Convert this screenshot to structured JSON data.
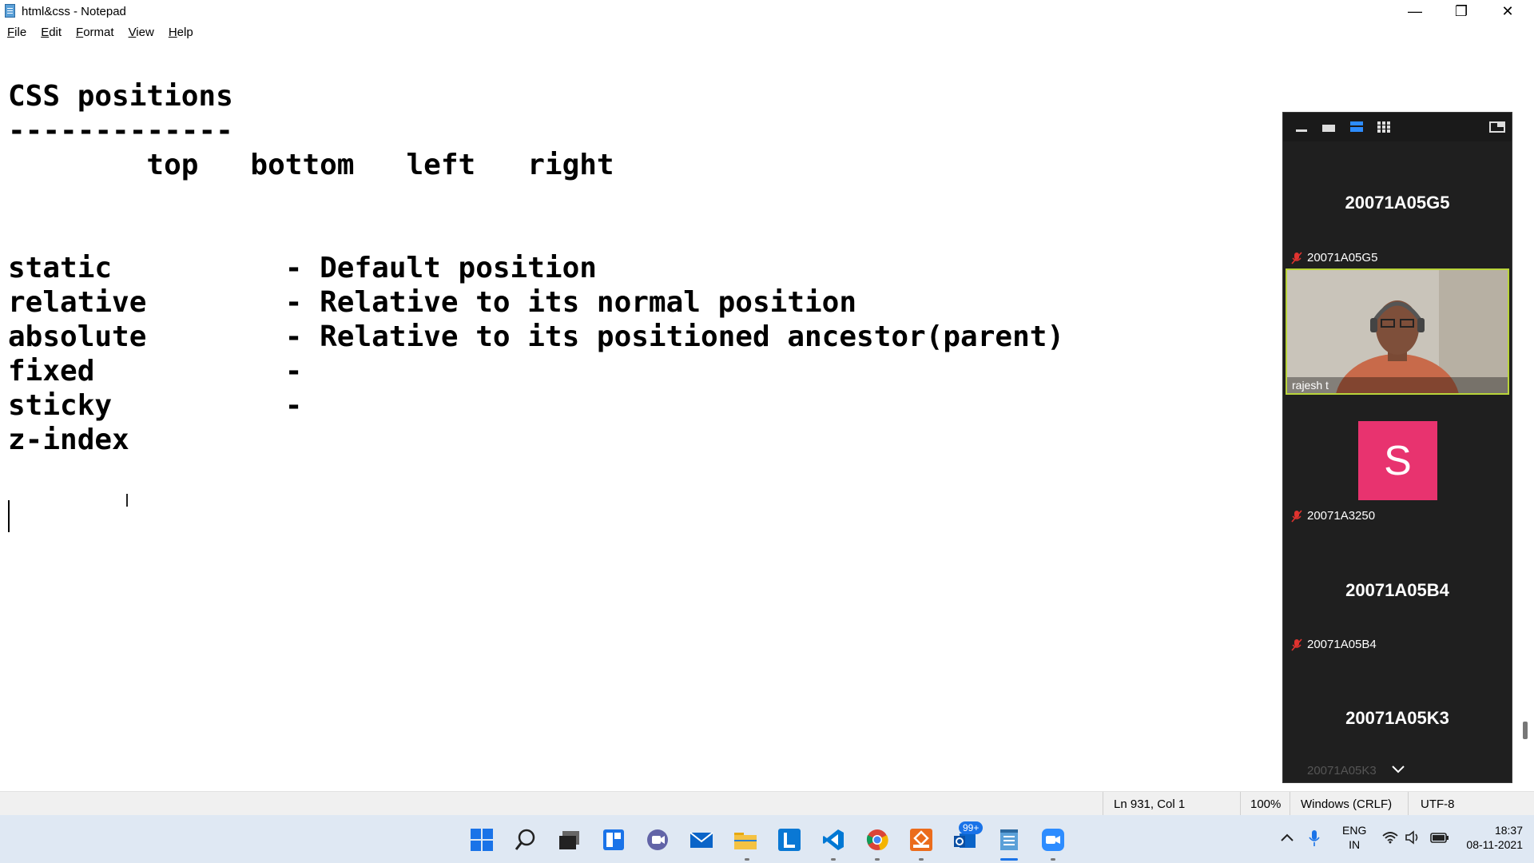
{
  "window": {
    "title": "html&css - Notepad",
    "controls": {
      "minimize": "—",
      "maximize": "❐",
      "close": "✕"
    }
  },
  "menu": [
    {
      "label": "File",
      "access": "F",
      "rest": "ile"
    },
    {
      "label": "Edit",
      "access": "E",
      "rest": "dit"
    },
    {
      "label": "Format",
      "access": "F",
      "rest": "ormat"
    },
    {
      "label": "View",
      "access": "V",
      "rest": "iew"
    },
    {
      "label": "Help",
      "access": "H",
      "rest": "elp"
    }
  ],
  "editor": {
    "lines": [
      "",
      "CSS positions",
      "-------------",
      "        top   bottom   left   right",
      "",
      "",
      "static          - Default position",
      "relative        - Relative to its normal position",
      "absolute        - Relative to its positioned ancestor(parent)",
      "fixed           -",
      "sticky          -",
      "z-index"
    ]
  },
  "status": {
    "position": "Ln 931, Col 1",
    "zoom": "100%",
    "line_ending": "Windows (CRLF)",
    "encoding": "UTF-8"
  },
  "zoom_panel": {
    "participants": [
      {
        "big_name": "20071A05G5",
        "label": "20071A05G5",
        "muted": true
      },
      {
        "label": "rajesh t",
        "video": true
      },
      {
        "avatar_letter": "S",
        "label": "20071A3250",
        "muted": true
      },
      {
        "big_name": "20071A05B4",
        "label": "20071A05B4",
        "muted": true
      },
      {
        "big_name": "20071A05K3",
        "label": "20071A05K3",
        "muted": true
      }
    ],
    "colors": {
      "avatar": "#e8336f",
      "active_border": "#b9d43a",
      "muted_icon": "#e0332f"
    }
  },
  "taskbar": {
    "apps": [
      "windows-start",
      "search",
      "task-view",
      "widgets",
      "teams-chat",
      "mail",
      "file-explorer",
      "learn",
      "vscode",
      "chrome",
      "ms-office",
      "outlook",
      "notepad",
      "zoom"
    ],
    "outlook_badge": "99+",
    "tray": {
      "language_top": "ENG",
      "language_bottom": "IN",
      "time": "18:37",
      "date": "08-11-2021"
    }
  }
}
